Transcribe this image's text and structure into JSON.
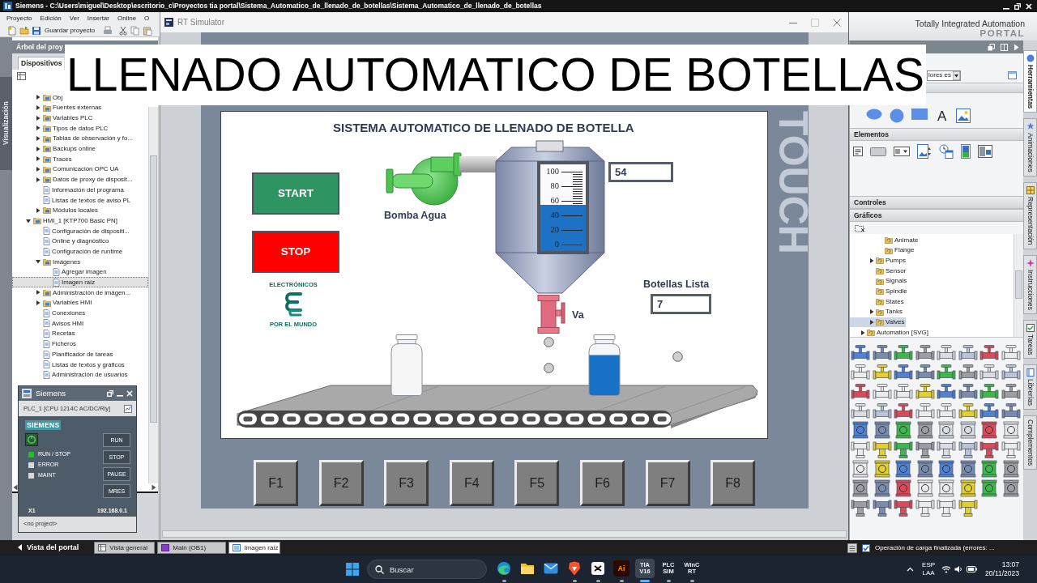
{
  "title_bar": {
    "title": "Siemens - C:\\Users\\miguel\\Desktop\\escritorio_c\\Proyectos tia portal\\Sistema_Automatico_de_llenado_de_botellas\\Sistema_Automatico_de_llenado_de_botellas"
  },
  "menu_bar": [
    "Proyecto",
    "Edición",
    "Ver",
    "Insertar",
    "Online",
    "O"
  ],
  "toolbar": {
    "save": "Guardar proyecto"
  },
  "side_tab": "Visualización",
  "project_tree": {
    "title": "Árbol del proy",
    "tabs": [
      {
        "label": "Dispositivos",
        "selected": true
      }
    ],
    "items": [
      {
        "children": [
          {
            "label": "Obj",
            "expanded": false,
            "selected": false
          },
          {
            "label": "Fuentes externas",
            "expanded": false,
            "selected": false
          },
          {
            "label": "Variables PLC",
            "expanded": false,
            "selected": false
          },
          {
            "label": "Tipos de datos PLC",
            "expanded": false,
            "selected": false
          },
          {
            "label": "Tablas de observación y fo...",
            "expanded": false,
            "selected": false
          },
          {
            "label": "Backups online",
            "expanded": false,
            "selected": false
          },
          {
            "label": "Traces",
            "expanded": false,
            "selected": false
          },
          {
            "label": "Comunicación OPC UA",
            "expanded": false,
            "selected": false
          },
          {
            "label": "Datos de proxy de disposit...",
            "expanded": false,
            "selected": false
          },
          {
            "label": "Información del programa",
            "selected": false
          },
          {
            "label": "Listas de textos de aviso PL",
            "selected": false
          },
          {
            "label": "Módulos locales",
            "expanded": false,
            "selected": false
          }
        ]
      },
      {
        "label": "HMI_1 [KTP700 Basic PN]",
        "expanded": true,
        "selected": false,
        "children": [
          {
            "label": "Configuración de dispositi...",
            "selected": false
          },
          {
            "label": "Online y diagnóstico",
            "selected": false
          },
          {
            "label": "Configuración de runtime",
            "selected": false
          },
          {
            "label": "Imágenes",
            "expanded": true,
            "selected": false,
            "children": [
              {
                "label": "Agregar imagen",
                "selected": false
              },
              {
                "label": "Imagen raíz",
                "selected": true
              }
            ]
          },
          {
            "label": "Administración de imágen...",
            "expanded": false,
            "selected": false
          },
          {
            "label": "Variables HMI",
            "expanded": false,
            "selected": false
          },
          {
            "label": "Conexiones",
            "selected": false
          },
          {
            "label": "Avisos HMI",
            "selected": false
          },
          {
            "label": "Recetas",
            "selected": false
          },
          {
            "label": "Ficheros",
            "selected": false
          },
          {
            "label": "Planificador de tareas",
            "selected": false
          },
          {
            "label": "Listas de textos y gráficos",
            "selected": false
          },
          {
            "label": "Administración de usuarios",
            "selected": false
          }
        ]
      }
    ]
  },
  "plcsim": {
    "title": "Siemens",
    "device": "PLC_1 [CPU 1214C AC/DC/Rly]",
    "brand": "SIEMENS",
    "leds": [
      {
        "label": "RUN / STOP",
        "on": true
      },
      {
        "label": "ERROR",
        "on": false
      },
      {
        "label": "MAINT",
        "on": false
      }
    ],
    "buttons": [
      "RUN",
      "STOP",
      "PAUSE",
      "MRES"
    ],
    "port": "X1",
    "ip": "192.168.0.1",
    "project": "<no project>"
  },
  "simulator": {
    "title": "RT Simulator",
    "panel_label": "TOUCH",
    "hmi": {
      "title": "SISTEMA AUTOMATICO DE LLENADO DE BOTELLA",
      "buttons": [
        {
          "label": "START",
          "color": "#2e9462"
        },
        {
          "label": "STOP",
          "color": "#ff0000"
        }
      ],
      "logo": {
        "top": "ELECTRÓNICOS",
        "bottom": "POR EL MUNDO"
      },
      "pump": {
        "label": "Bomba Agua"
      },
      "tank": {
        "level": 0.54,
        "scale": [
          "100",
          "80",
          "60",
          "40",
          "20",
          "0"
        ]
      },
      "level_field": "54",
      "bottles_field": {
        "label": "Botellas Lista",
        "value": "7"
      },
      "valve": {
        "label": "Va"
      },
      "bottles": [
        {
          "filled": false
        },
        {
          "filled": true
        }
      ]
    },
    "function_keys": [
      "F1",
      "F2",
      "F3",
      "F4",
      "F5",
      "F6",
      "F7",
      "F8"
    ]
  },
  "caption": "LLENADO AUTOMATICO DE BOTELLAS",
  "portal": {
    "line1": "Totally Integrated Automation",
    "line2": "PORTAL"
  },
  "task_card": {
    "dropdown": "lores es",
    "text_tool": "A",
    "sections": [
      {
        "label": "Elementos"
      },
      {
        "label": "Controles"
      },
      {
        "label": "Gráficos"
      }
    ],
    "graphics_tree": [
      {
        "children": [
          {
            "children": [
              {
                "label": "Animate",
                "selected": false
              },
              {
                "label": "Flange",
                "selected": false
              }
            ]
          },
          {
            "label": "Pumps",
            "expanded": false,
            "selected": false
          },
          {
            "label": "Sensor",
            "selected": false
          },
          {
            "label": "Signals",
            "selected": false
          },
          {
            "label": "Spindle",
            "selected": false
          },
          {
            "label": "States",
            "selected": false
          },
          {
            "label": "Tanks",
            "expanded": false,
            "selected": false
          },
          {
            "label": "Valves",
            "expanded": false,
            "selected": true
          }
        ]
      },
      {
        "label": "Automation [SVG]",
        "expanded": false,
        "selected": false
      }
    ],
    "tabs": [
      {
        "label": "Herramientas",
        "selected": true
      },
      {
        "label": "Animaciones",
        "selected": false
      },
      {
        "label": "Representación",
        "selected": false
      },
      {
        "label": "Instrucciones",
        "selected": false
      },
      {
        "label": "Tareas",
        "selected": false
      },
      {
        "label": "Librerías",
        "selected": false
      },
      {
        "label": "Complementos",
        "selected": false
      }
    ]
  },
  "status_bar": {
    "portal_view": "Vista del portal",
    "tabs": [
      {
        "label": "Vista general",
        "selected": false
      },
      {
        "label": "Main (OB1)",
        "selected": false
      },
      {
        "label": "Imagen raíz",
        "selected": true
      }
    ],
    "message": "Operación de carga finalizada (errores: ..."
  },
  "taskbar": {
    "search": {
      "placeholder": "Buscar"
    },
    "apps": [
      {
        "kind": "browser",
        "running": true,
        "selected": false
      },
      {
        "kind": "folder",
        "running": false,
        "selected": false
      },
      {
        "kind": "mail",
        "running": false,
        "selected": false
      },
      {
        "kind": "shield",
        "running": true,
        "selected": false
      },
      {
        "kind": "square",
        "running": true,
        "selected": false
      },
      {
        "kind": "tile",
        "lines": [
          "Ai"
        ],
        "running": true,
        "selected": false
      },
      {
        "kind": "text",
        "lines": [
          "TIA",
          "V16"
        ],
        "running": true,
        "selected": true
      },
      {
        "kind": "text",
        "lines": [
          "PLC",
          "SIM"
        ],
        "running": true,
        "selected": false
      },
      {
        "kind": "text",
        "lines": [
          "WinC",
          "RT"
        ],
        "running": true,
        "selected": false
      }
    ],
    "language": [
      "ESP",
      "LAA"
    ],
    "time": "13:07",
    "date": "20/11/2023"
  }
}
